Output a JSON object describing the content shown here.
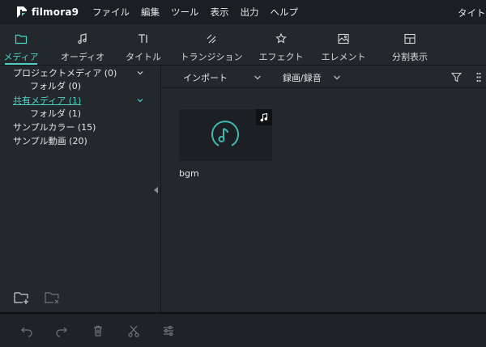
{
  "app": {
    "logo_text": "filmora9",
    "menu": [
      "ファイル",
      "編集",
      "ツール",
      "表示",
      "出力",
      "ヘルプ"
    ],
    "menu_right": "タイトル"
  },
  "tabs": [
    {
      "label": "メディア",
      "icon": "folder-icon",
      "active": true
    },
    {
      "label": "オーディオ",
      "icon": "music-note-icon",
      "active": false
    },
    {
      "label": "タイトル",
      "icon": "title-text-icon",
      "active": false
    },
    {
      "label": "トランジション",
      "icon": "transition-icon",
      "active": false
    },
    {
      "label": "エフェクト",
      "icon": "effects-star-icon",
      "active": false
    },
    {
      "label": "エレメント",
      "icon": "image-element-icon",
      "active": false
    },
    {
      "label": "分割表示",
      "icon": "split-screen-icon",
      "active": false
    }
  ],
  "sidebar": {
    "items": [
      {
        "label": "プロジェクトメディア (0)",
        "indent": false,
        "highlight": false,
        "chevron": true
      },
      {
        "label": "フォルダ (0)",
        "indent": true,
        "highlight": false,
        "chevron": false
      },
      {
        "label": "共有メディア (1)",
        "indent": false,
        "highlight": true,
        "chevron": true
      },
      {
        "label": "フォルダ (1)",
        "indent": true,
        "highlight": false,
        "chevron": false
      },
      {
        "label": "サンプルカラー (15)",
        "indent": false,
        "highlight": false,
        "chevron": false
      },
      {
        "label": "サンプル動画 (20)",
        "indent": false,
        "highlight": false,
        "chevron": false
      }
    ]
  },
  "media_toolbar": {
    "import_label": "インポート",
    "record_label": "録画/録音"
  },
  "media_items": [
    {
      "name": "bgm",
      "type": "audio"
    }
  ],
  "colors": {
    "accent": "#4fd1c5",
    "background": "#23282d",
    "menubar": "#1b1f23"
  }
}
